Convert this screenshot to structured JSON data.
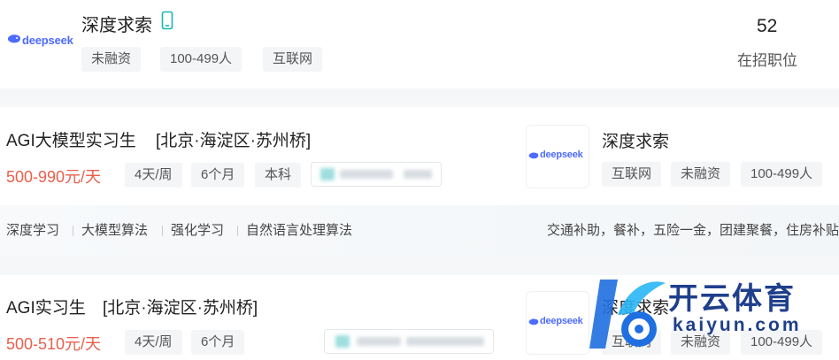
{
  "company_card": {
    "logo_text": "deepseek",
    "name": "深度求索",
    "tags": [
      "未融资",
      "100-499人",
      "互联网"
    ],
    "job_count": "52",
    "job_count_label": "在招职位"
  },
  "jobs": [
    {
      "title": "AGI大模型实习生",
      "location": "[北京·海淀区·苏州桥]",
      "salary": "500-990元/天",
      "tags": [
        "4天/周",
        "6个月",
        "本科"
      ],
      "company_logo_text": "deepseek",
      "company_name": "深度求索",
      "company_tags": [
        "互联网",
        "未融资",
        "100-499人"
      ],
      "skills": [
        "深度学习",
        "大模型算法",
        "强化学习",
        "自然语言处理算法"
      ],
      "benefits": "交通补助，餐补，五险一金，团建聚餐，住房补贴"
    },
    {
      "title": "AGI实习生",
      "location": "[北京·海淀区·苏州桥]",
      "salary": "500-510元/天",
      "tags": [
        "4天/周",
        "6个月"
      ],
      "company_logo_text": "deepseek",
      "company_name": "深度求索",
      "company_tags": [
        "互联网",
        "未融资",
        "100-499人"
      ]
    }
  ],
  "watermark": {
    "cn": "开云体育",
    "en": "kaiyun.com"
  },
  "colors": {
    "salary": "#e8604c",
    "brand": "#4d6bfe",
    "watermark": "#1f3f8c"
  }
}
